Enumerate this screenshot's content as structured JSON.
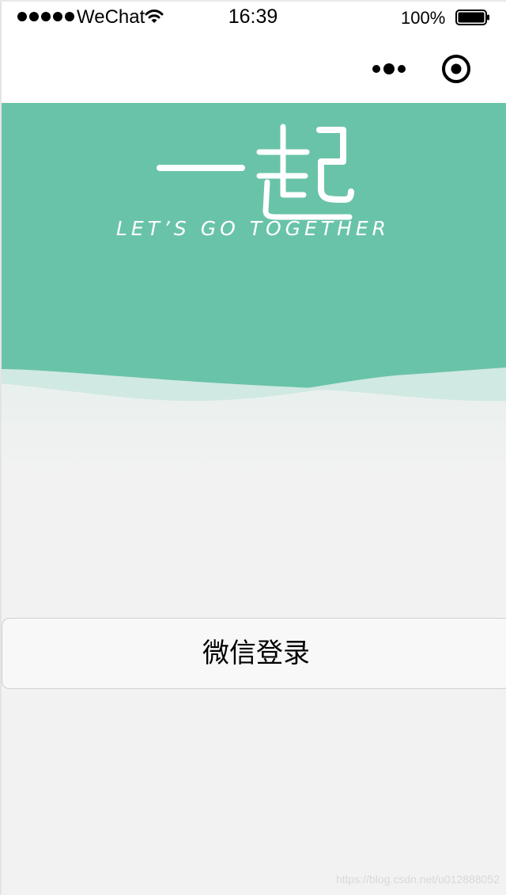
{
  "status_bar": {
    "carrier": "WeChat",
    "time": "16:39",
    "battery": "100%"
  },
  "nav_bar": {
    "more_icon": "more-dots-icon",
    "close_icon": "target-close-icon"
  },
  "hero": {
    "logo_text": "一起",
    "logo_subtitle": "LET’S GO TOGETHER"
  },
  "login": {
    "button_label": "微信登录"
  },
  "footer": {
    "watermark": "https://blog.csdn.net/u012888052"
  },
  "colors": {
    "accent": "#69c3a9",
    "background": "#f2f2f2"
  }
}
